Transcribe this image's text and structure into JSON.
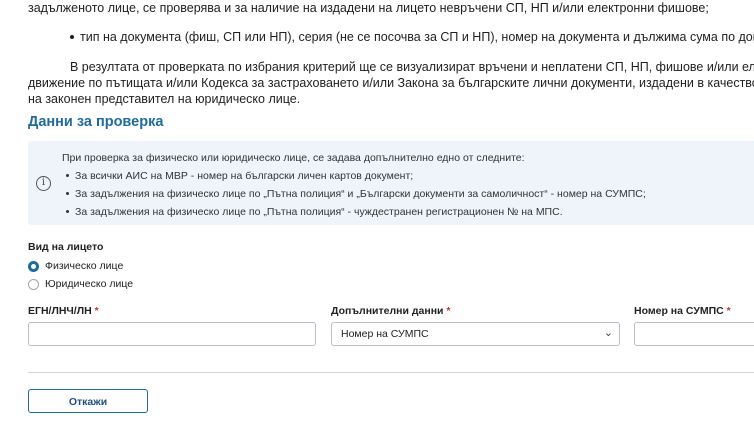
{
  "intro": {
    "line1": "задълженото лице, се проверява и за наличие на издадени на лицето невръчени СП, НП и/или електронни фишове;",
    "bullet1": "тип на документа (фиш, СП или НП), серия (не се посочва за СП и НП), номер на документа и дължима сума по доку",
    "para_line1": "В резултата от проверката по избрания критерий ще се визуализират връчени и неплатени СП, НП, фишове и/или елек",
    "para_line2": "движение по пътищата и/или Кодекса за застраховането и/или Закона за българските лични документи, издадени в качество",
    "para_line3": "на законен представител на юридическо лице."
  },
  "section_title": "Данни за проверка",
  "info": {
    "icon": "info-circle-icon",
    "heading": "При проверка за физическо или юридическо лице, се задава допълнително едно от следните:",
    "items": [
      "За всички АИС на МВР - номер на български личен картов документ;",
      "За задължения на физическо лице по „Пътна полиция“ и „Български документи за самоличност“ - номер на СУМПС;",
      "За задължения на физическо лице по „Пътна полиция“ - чуждестранен регистрационен № на МПС."
    ]
  },
  "person_type": {
    "label": "Вид на лицето",
    "options": [
      "Физическо лице",
      "Юридическо лице"
    ],
    "selected": "Физическо лице"
  },
  "fields": {
    "egn_label": "ЕГН/ЛНЧ/ЛН",
    "egn_value": "",
    "additional_label": "Допълнителни данни",
    "additional_selected": "Номер на СУМПС",
    "sumps_label": "Номер на СУМПС",
    "sumps_value": "",
    "required_mark": "*"
  },
  "actions": {
    "cancel_label": "Откажи"
  },
  "colors": {
    "accent": "#1f6b9a",
    "info_bg": "#eef4fa",
    "required": "#c0392b"
  }
}
